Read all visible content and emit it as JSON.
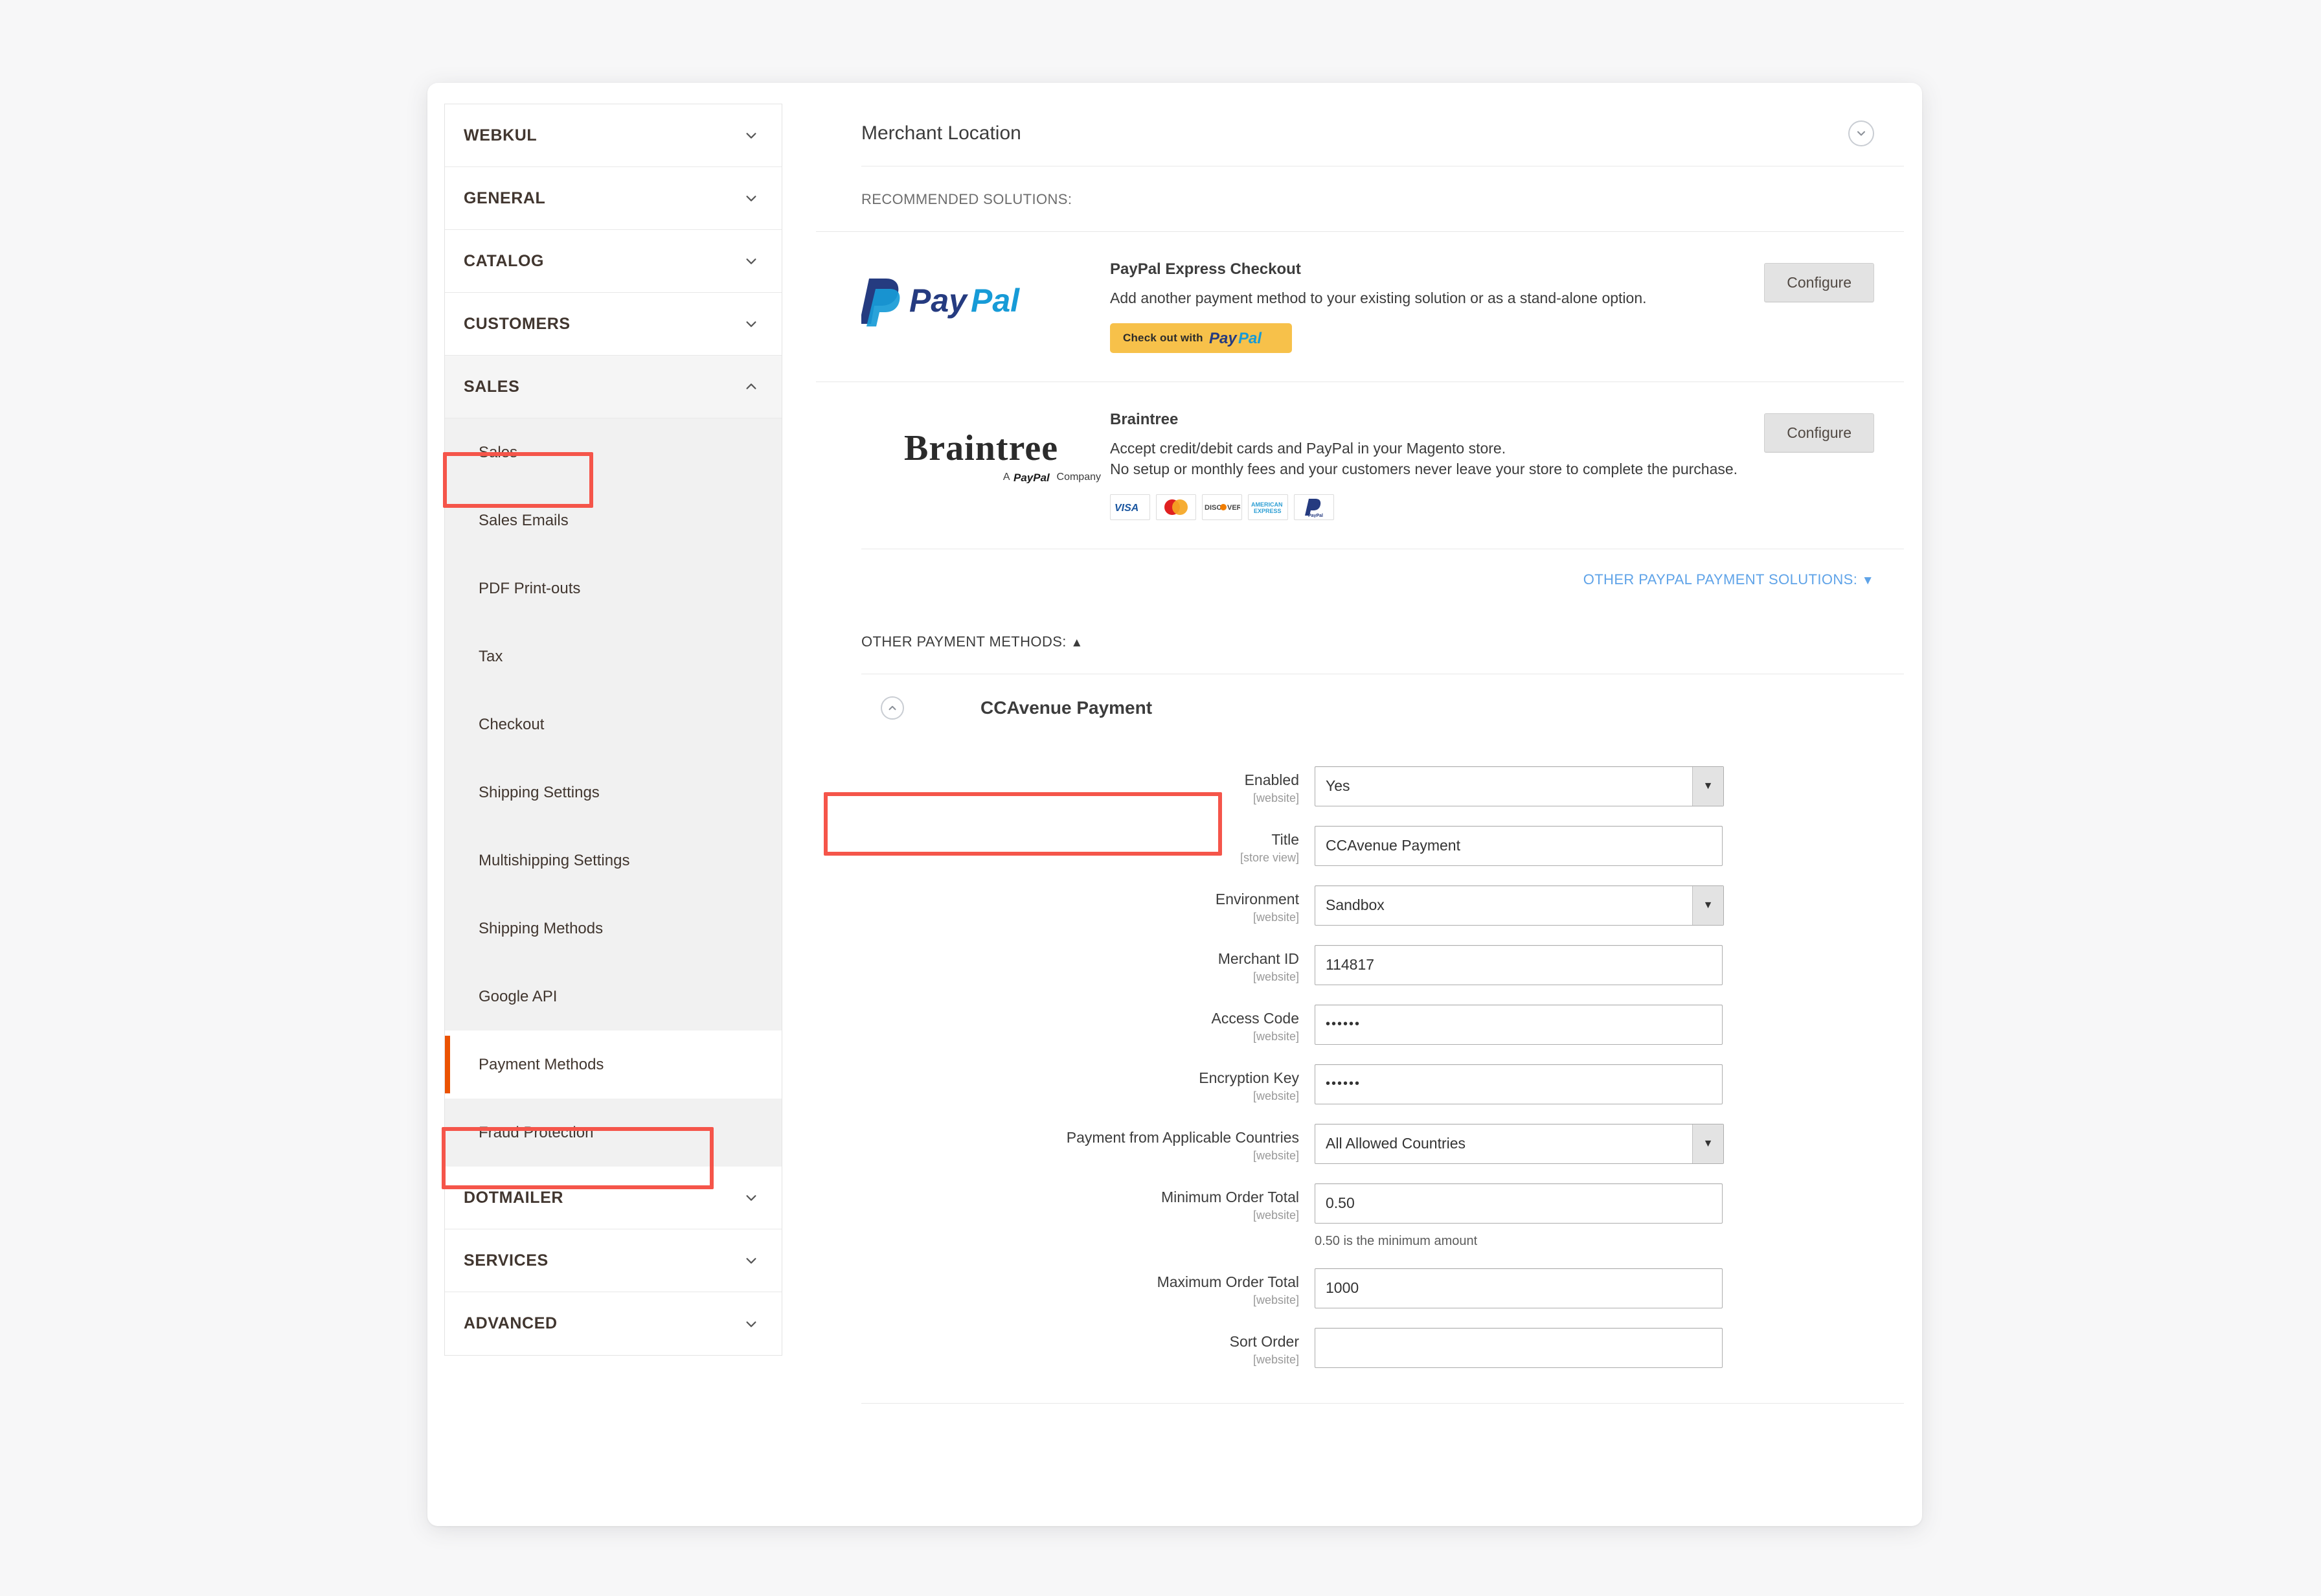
{
  "sidebar": {
    "sections": [
      {
        "label": "WEBKUL",
        "state": "collapsed"
      },
      {
        "label": "GENERAL",
        "state": "collapsed"
      },
      {
        "label": "CATALOG",
        "state": "collapsed"
      },
      {
        "label": "CUSTOMERS",
        "state": "collapsed"
      },
      {
        "label": "SALES",
        "state": "expanded"
      },
      {
        "label": "DOTMAILER",
        "state": "collapsed"
      },
      {
        "label": "SERVICES",
        "state": "collapsed"
      },
      {
        "label": "ADVANCED",
        "state": "collapsed"
      }
    ],
    "sales_items": [
      {
        "label": "Sales"
      },
      {
        "label": "Sales Emails"
      },
      {
        "label": "PDF Print-outs"
      },
      {
        "label": "Tax"
      },
      {
        "label": "Checkout"
      },
      {
        "label": "Shipping Settings"
      },
      {
        "label": "Multishipping Settings"
      },
      {
        "label": "Shipping Methods"
      },
      {
        "label": "Google API"
      },
      {
        "label": "Payment Methods"
      },
      {
        "label": "Fraud Protection"
      }
    ]
  },
  "main": {
    "merchant_location_title": "Merchant Location",
    "recommended_label": "RECOMMENDED SOLUTIONS:",
    "paypal": {
      "logo_text": "PayPal",
      "title": "PayPal Express Checkout",
      "description": "Add another payment method to your existing solution or as a stand-alone option.",
      "checkout_button_prefix": "Check out with",
      "checkout_button_brand": "PayPal",
      "configure_label": "Configure"
    },
    "braintree": {
      "logo_text": "Braintree",
      "logo_sub_prefix": "A",
      "logo_sub_brand": "PayPal",
      "logo_sub_suffix": "Company",
      "title": "Braintree",
      "description_line1": "Accept credit/debit cards and PayPal in your Magento store.",
      "description_line2": "No setup or monthly fees and your customers never leave your store to complete the purchase.",
      "configure_label": "Configure",
      "cards": [
        "VISA",
        "MasterCard",
        "DISCOVER",
        "AMERICAN EXPRESS",
        "PayPal"
      ]
    },
    "other_paypal_link": "OTHER PAYPAL PAYMENT SOLUTIONS:",
    "other_paypal_caret": "▼",
    "other_payment_methods_label": "OTHER PAYMENT METHODS:",
    "other_payment_methods_caret": "▲"
  },
  "ccavenue": {
    "section_title": "CCAvenue Payment",
    "fields": [
      {
        "label": "Enabled",
        "scope": "[website]",
        "type": "select",
        "value": "Yes"
      },
      {
        "label": "Title",
        "scope": "[store view]",
        "type": "text",
        "value": "CCAvenue Payment"
      },
      {
        "label": "Environment",
        "scope": "[website]",
        "type": "select",
        "value": "Sandbox"
      },
      {
        "label": "Merchant ID",
        "scope": "[website]",
        "type": "text",
        "value": "114817"
      },
      {
        "label": "Access Code",
        "scope": "[website]",
        "type": "password",
        "value": "••••••"
      },
      {
        "label": "Encryption Key",
        "scope": "[website]",
        "type": "password",
        "value": "••••••"
      },
      {
        "label": "Payment from Applicable Countries",
        "scope": "[website]",
        "type": "select",
        "value": "All Allowed Countries"
      },
      {
        "label": "Minimum Order Total",
        "scope": "[website]",
        "type": "text",
        "value": "0.50",
        "hint": "0.50 is the minimum amount"
      },
      {
        "label": "Maximum Order Total",
        "scope": "[website]",
        "type": "text",
        "value": "1000"
      },
      {
        "label": "Sort Order",
        "scope": "[website]",
        "type": "text",
        "value": ""
      }
    ]
  },
  "colors": {
    "accent_orange": "#eb5202",
    "annotation_red": "#f5554a",
    "link_blue": "#5fa3e8",
    "paypal_dark": "#253b80",
    "paypal_light": "#179bd7",
    "paypal_button_yellow": "#f7c14a"
  }
}
